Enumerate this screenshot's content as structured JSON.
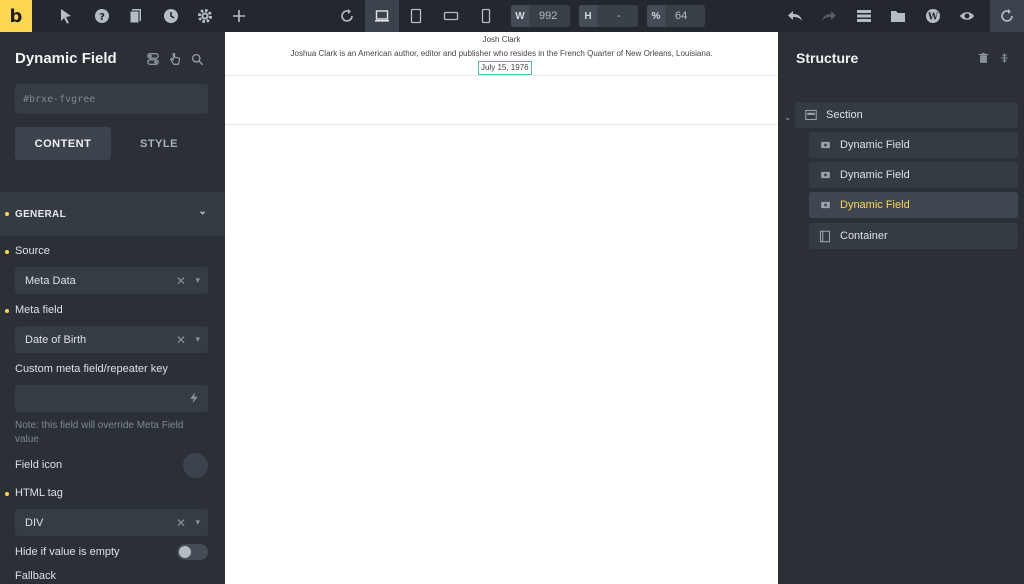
{
  "topbar": {
    "logo": "b",
    "width_label": "W",
    "width_value": "992",
    "height_label": "H",
    "height_value": "-",
    "zoom_label": "%",
    "zoom_value": "64"
  },
  "left_panel": {
    "title": "Dynamic Field",
    "css_id": "#brxe-fvgree",
    "tabs": [
      "CONTENT",
      "STYLE"
    ],
    "group": "GENERAL",
    "fields": {
      "source_label": "Source",
      "source_value": "Meta Data",
      "meta_label": "Meta field",
      "meta_value": "Date of Birth",
      "custom_label": "Custom meta field/repeater key",
      "custom_value": "",
      "note": "Note: this field will override Meta Field value",
      "icon_label": "Field icon",
      "tag_label": "HTML tag",
      "tag_value": "DIV",
      "hide_label": "Hide if value is empty",
      "fallback_label": "Fallback"
    }
  },
  "preview": {
    "name": "Josh Clark",
    "bio": "Joshua Clark is an American author, editor and publisher who resides in the French Quarter of New Orleans, Louisiana.",
    "date": "July 15, 1976"
  },
  "structure": {
    "title": "Structure",
    "items": [
      {
        "label": "Section"
      },
      {
        "label": "Dynamic Field"
      },
      {
        "label": "Dynamic Field"
      },
      {
        "label": "Dynamic Field"
      },
      {
        "label": "Container"
      }
    ]
  },
  "colors": {
    "accent": "#ffd64f",
    "panel": "#2b3037",
    "selection": "#4fbfa5"
  }
}
